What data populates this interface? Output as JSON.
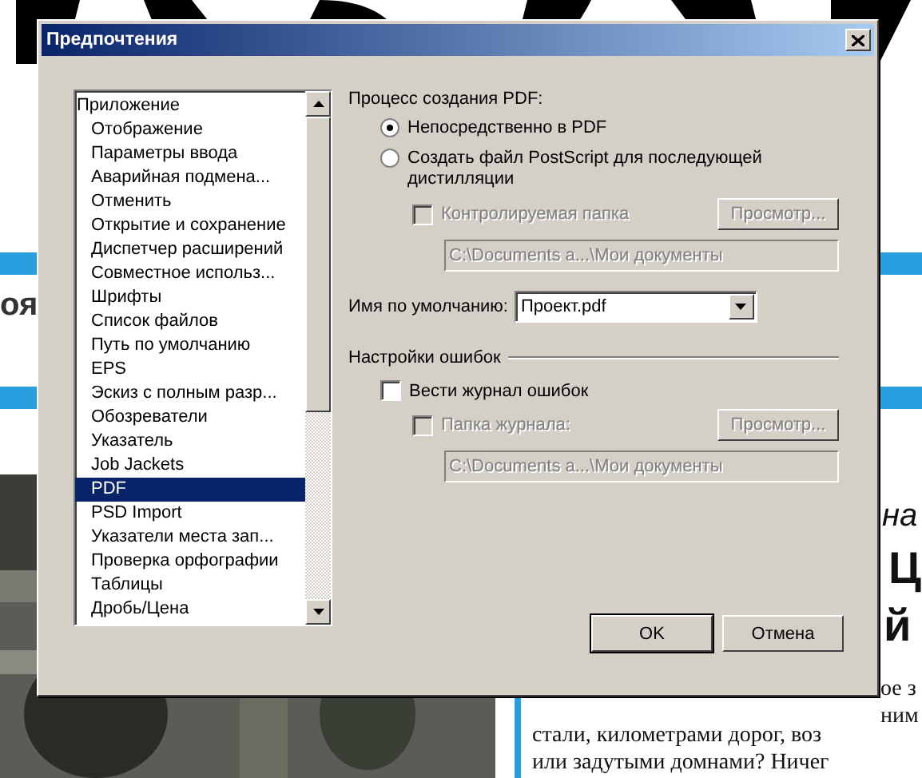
{
  "background": {
    "texts": [
      {
        "kind": "headline",
        "text": "оя"
      },
      {
        "kind": "italic",
        "text": "на"
      },
      {
        "kind": "headline-right",
        "text": "Ц"
      },
      {
        "kind": "headline-right2",
        "text": "й"
      },
      {
        "kind": "body1",
        "text": "ое з"
      },
      {
        "kind": "body2",
        "text": "ним"
      },
      {
        "kind": "body3",
        "text": "стали, километрами дорог, воз"
      },
      {
        "kind": "body4",
        "text": "или задутыми домнами? Ничег"
      }
    ]
  },
  "dialog": {
    "title": "Предпочтения",
    "categories": [
      {
        "label": "Приложение",
        "selected": false,
        "children": [
          {
            "label": "Отображение",
            "selected": false
          },
          {
            "label": "Параметры ввода",
            "selected": false
          },
          {
            "label": "Аварийная подмена...",
            "selected": false
          },
          {
            "label": "Отменить",
            "selected": false
          },
          {
            "label": "Открытие и сохранение",
            "selected": false
          },
          {
            "label": "Диспетчер расширений",
            "selected": false
          },
          {
            "label": "Совместное использ...",
            "selected": false
          },
          {
            "label": "Шрифты",
            "selected": false
          },
          {
            "label": "Список файлов",
            "selected": false
          },
          {
            "label": "Путь по умолчанию",
            "selected": false
          },
          {
            "label": "EPS",
            "selected": false
          },
          {
            "label": "Эскиз с полным разр...",
            "selected": false
          },
          {
            "label": "Обозреватели",
            "selected": false
          },
          {
            "label": "Указатель",
            "selected": false
          },
          {
            "label": "Job Jackets",
            "selected": false
          },
          {
            "label": "PDF",
            "selected": true
          },
          {
            "label": "PSD Import",
            "selected": false
          },
          {
            "label": "Указатели места зап...",
            "selected": false
          },
          {
            "label": "Проверка орфографии",
            "selected": false
          },
          {
            "label": "Таблицы",
            "selected": false
          },
          {
            "label": "Дробь/Цена",
            "selected": false
          }
        ]
      }
    ],
    "pdf_process": {
      "label": "Процесс создания PDF:",
      "options": [
        {
          "label": "Непосредственно в PDF",
          "selected": true
        },
        {
          "label": "Создать файл PostScript для последующей дистилляции",
          "selected": false
        }
      ]
    },
    "watched_folder": {
      "label": "Контролируемая папка",
      "checked": false,
      "disabled": true,
      "browse": "Просмотр...",
      "path": "C:\\Documents a...\\Мои документы"
    },
    "default_name": {
      "label": "Имя по умолчанию:",
      "value": "Проект.pdf"
    },
    "error_settings": {
      "title": "Настройки ошибок",
      "log": {
        "label": "Вести журнал ошибок",
        "checked": false,
        "disabled": false
      },
      "log_folder": {
        "label": "Папка журнала:",
        "checked": false,
        "disabled": true,
        "browse": "Просмотр...",
        "path": "C:\\Documents a...\\Мои документы"
      }
    },
    "buttons": [
      {
        "label": "OK",
        "default": true
      },
      {
        "label": "Отмена",
        "default": false
      }
    ]
  }
}
